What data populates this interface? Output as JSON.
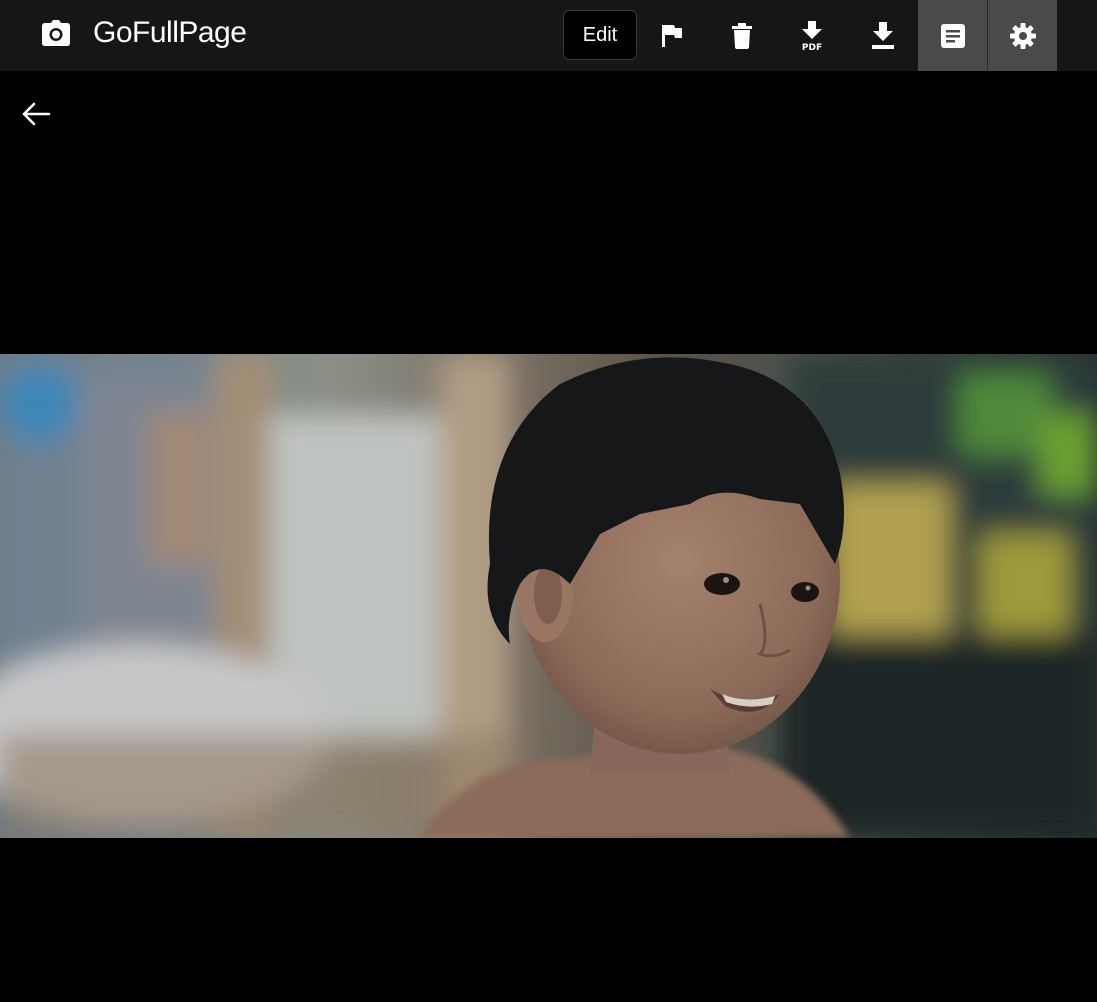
{
  "toolbar": {
    "brand_icon": "camera-icon",
    "brand_title": "GoFullPage",
    "edit_label": "Edit",
    "buttons": [
      {
        "icon": "flag-icon",
        "active": false
      },
      {
        "icon": "trash-icon",
        "active": false
      },
      {
        "icon": "download-pdf-icon",
        "label": "PDF",
        "active": false
      },
      {
        "icon": "download-icon",
        "active": false
      },
      {
        "icon": "notes-icon",
        "active": true
      },
      {
        "icon": "gear-icon",
        "active": true
      }
    ]
  },
  "viewer": {
    "back_icon": "arrow-left-icon",
    "image_subject": "screenshot-photo"
  },
  "colors": {
    "toolbar_bg": "#161616",
    "active_bg": "#4a4a4a",
    "page_bg": "#000000",
    "icon": "#ffffff"
  }
}
